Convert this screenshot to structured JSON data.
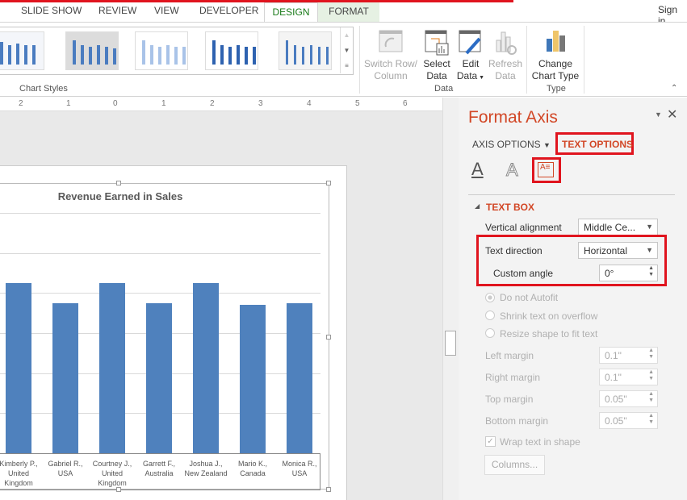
{
  "tabs": [
    "SLIDE SHOW",
    "REVIEW",
    "VIEW",
    "DEVELOPER",
    "DESIGN",
    "FORMAT"
  ],
  "active_tab": "DESIGN",
  "sign_in": "Sign in",
  "ribbon": {
    "chart_styles_label": "Chart Styles",
    "data_group_label": "Data",
    "type_group_label": "Type",
    "switch_row_column": [
      "Switch Row/",
      "Column"
    ],
    "select_data": [
      "Select",
      "Data"
    ],
    "edit_data": [
      "Edit",
      "Data"
    ],
    "refresh_data": [
      "Refresh",
      "Data"
    ],
    "change_chart_type": [
      "Change",
      "Chart Type"
    ]
  },
  "ruler_labels": [
    "2",
    "1",
    "0",
    "1",
    "2",
    "3",
    "4",
    "5",
    "6"
  ],
  "chart": {
    "title": "Revenue Earned in Sales",
    "bar_color": "#4f81bd",
    "categories": [
      [
        "Kimberly P.,",
        "United",
        "Kingdom"
      ],
      [
        "Gabriel R.,",
        "USA"
      ],
      [
        "Courtney J.,",
        "United",
        "Kingdom"
      ],
      [
        "Garrett F.,",
        "Australia"
      ],
      [
        "Joshua J.,",
        "New Zealand"
      ],
      [
        "Mario K.,",
        "Canada"
      ],
      [
        "Monica R.,",
        "USA"
      ]
    ],
    "relative_values": [
      4.25,
      3.75,
      4.25,
      3.75,
      4.25,
      3.7,
      3.75
    ]
  },
  "panel": {
    "title": "Format Axis",
    "axis_options": "AXIS OPTIONS",
    "text_options": "TEXT OPTIONS",
    "accent": "#d24726",
    "section": "TEXT BOX",
    "vertical_alignment": {
      "label": "Vertical alignment",
      "value": "Middle Ce..."
    },
    "text_direction": {
      "label": "Text direction",
      "value": "Horizontal"
    },
    "custom_angle": {
      "label": "Custom angle",
      "value": "0°"
    },
    "autofit": [
      "Do not Autofit",
      "Shrink text on overflow",
      "Resize shape to fit text"
    ],
    "margins": [
      {
        "label": "Left margin",
        "value": "0.1\""
      },
      {
        "label": "Right margin",
        "value": "0.1\""
      },
      {
        "label": "Top margin",
        "value": "0.05\""
      },
      {
        "label": "Bottom margin",
        "value": "0.05\""
      }
    ],
    "wrap_text": {
      "label": "Wrap text in shape",
      "checked": true
    },
    "columns_button": "Columns..."
  }
}
